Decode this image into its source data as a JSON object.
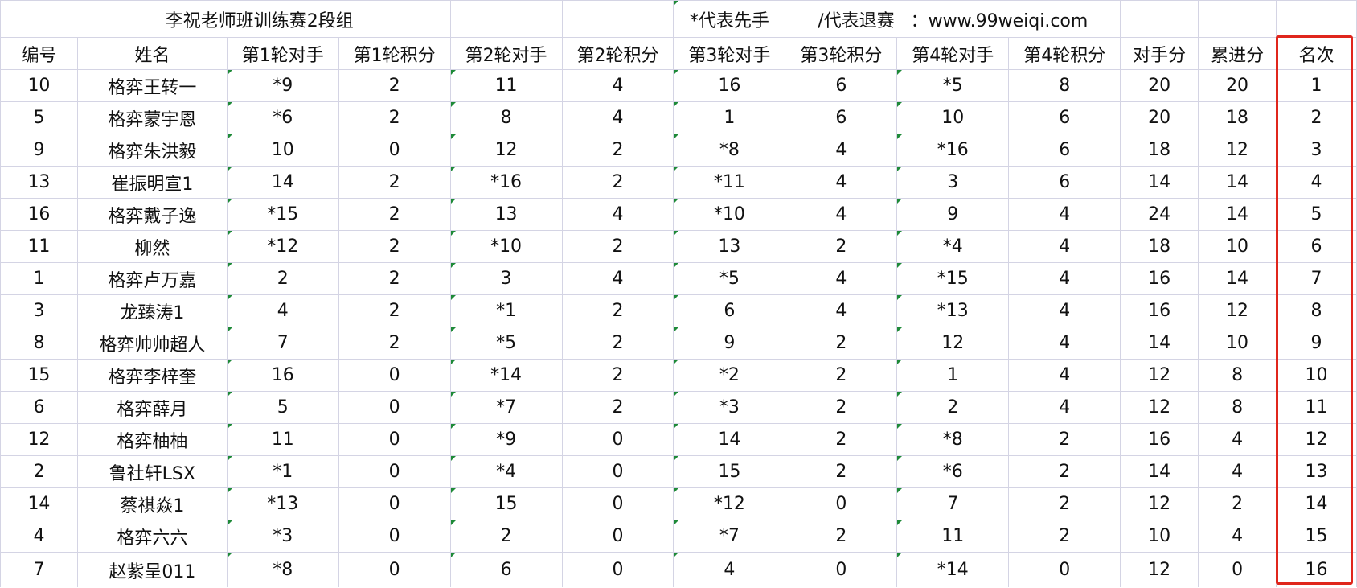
{
  "sheet": {
    "title": "李祝老师班训练赛2段组",
    "note_first_move": "*代表先手",
    "note_withdraw": "/代表退赛",
    "note_website": "：www.99weiqi.com",
    "columns": [
      "编号",
      "姓名",
      "第1轮对手",
      "第1轮积分",
      "第2轮对手",
      "第2轮积分",
      "第3轮对手",
      "第3轮积分",
      "第4轮对手",
      "第4轮积分",
      "对手分",
      "累进分",
      "名次"
    ],
    "rows": [
      [
        "10",
        "格弈王转一",
        "*9",
        "2",
        "11",
        "4",
        "16",
        "6",
        "*5",
        "8",
        "20",
        "20",
        "1"
      ],
      [
        "5",
        "格弈蒙宇恩",
        "*6",
        "2",
        "8",
        "4",
        "1",
        "6",
        "10",
        "6",
        "20",
        "18",
        "2"
      ],
      [
        "9",
        "格弈朱洪毅",
        "10",
        "0",
        "12",
        "2",
        "*8",
        "4",
        "*16",
        "6",
        "18",
        "12",
        "3"
      ],
      [
        "13",
        "崔振明宣1",
        "14",
        "2",
        "*16",
        "2",
        "*11",
        "4",
        "3",
        "6",
        "14",
        "14",
        "4"
      ],
      [
        "16",
        "格弈戴子逸",
        "*15",
        "2",
        "13",
        "4",
        "*10",
        "4",
        "9",
        "4",
        "24",
        "14",
        "5"
      ],
      [
        "11",
        "柳然",
        "*12",
        "2",
        "*10",
        "2",
        "13",
        "2",
        "*4",
        "4",
        "18",
        "10",
        "6"
      ],
      [
        "1",
        "格弈卢万嘉",
        "2",
        "2",
        "3",
        "4",
        "*5",
        "4",
        "*15",
        "4",
        "16",
        "14",
        "7"
      ],
      [
        "3",
        "龙臻涛1",
        "4",
        "2",
        "*1",
        "2",
        "6",
        "4",
        "*13",
        "4",
        "16",
        "12",
        "8"
      ],
      [
        "8",
        "格弈帅帅超人",
        "7",
        "2",
        "*5",
        "2",
        "9",
        "2",
        "12",
        "4",
        "14",
        "10",
        "9"
      ],
      [
        "15",
        "格弈李梓奎",
        "16",
        "0",
        "*14",
        "2",
        "*2",
        "2",
        "1",
        "4",
        "12",
        "8",
        "10"
      ],
      [
        "6",
        "格弈薛月",
        "5",
        "0",
        "*7",
        "2",
        "*3",
        "2",
        "2",
        "4",
        "12",
        "8",
        "11"
      ],
      [
        "12",
        "格弈柚柚",
        "11",
        "0",
        "*9",
        "0",
        "14",
        "2",
        "*8",
        "2",
        "16",
        "4",
        "12"
      ],
      [
        "2",
        "鲁社轩LSX",
        "*1",
        "0",
        "*4",
        "0",
        "15",
        "2",
        "*6",
        "2",
        "14",
        "4",
        "13"
      ],
      [
        "14",
        "蔡祺焱1",
        "*13",
        "0",
        "15",
        "0",
        "*12",
        "0",
        "7",
        "2",
        "12",
        "2",
        "14"
      ],
      [
        "4",
        "格弈六六",
        "*3",
        "0",
        "2",
        "0",
        "*7",
        "2",
        "11",
        "2",
        "10",
        "4",
        "15"
      ],
      [
        "7",
        "赵紫呈011",
        "*8",
        "0",
        "6",
        "0",
        "4",
        "0",
        "*14",
        "0",
        "12",
        "0",
        "16"
      ]
    ]
  },
  "colors": {
    "gridline": "#d4d4e4",
    "highlight": "#e0261c",
    "cell_flag": "#1e8a38"
  }
}
